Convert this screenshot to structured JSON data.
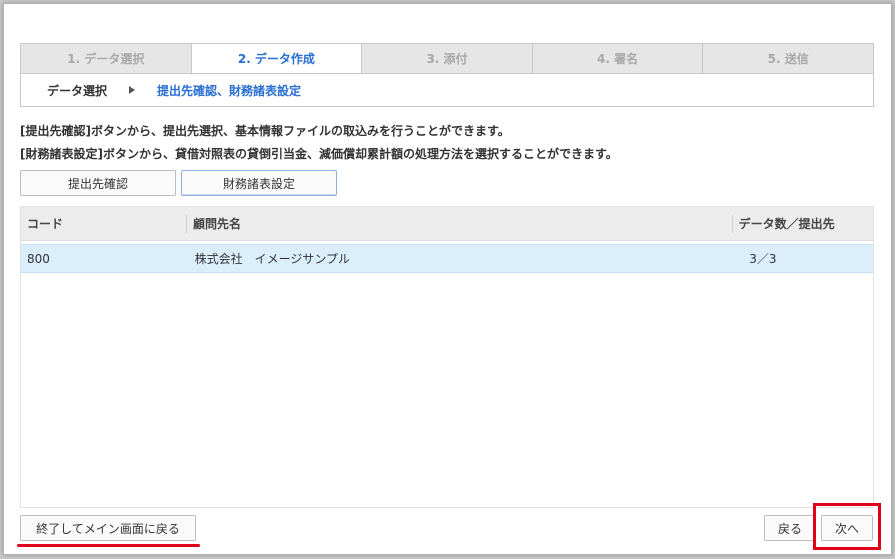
{
  "steps": [
    {
      "label": "1. データ選択",
      "active": false
    },
    {
      "label": "2. データ作成",
      "active": true
    },
    {
      "label": "3. 添付",
      "active": false
    },
    {
      "label": "4. 署名",
      "active": false
    },
    {
      "label": "5. 送信",
      "active": false
    }
  ],
  "substeps": {
    "done": "データ選択",
    "current": "提出先確認、財務諸表設定"
  },
  "description": {
    "line1": "[提出先確認]ボタンから、提出先選択、基本情報ファイルの取込みを行うことができます。",
    "line2": "[財務諸表設定]ボタンから、貸借対照表の貸倒引当金、減価償却累計額の処理方法を選択することができます。"
  },
  "buttons": {
    "confirm": "提出先確認",
    "settings": "財務諸表設定",
    "exit": "終了してメイン画面に戻る",
    "back": "戻る",
    "next": "次へ"
  },
  "table": {
    "headers": [
      "コード",
      "顧問先名",
      "データ数／提出先"
    ],
    "rows": [
      {
        "code": "800",
        "name": "株式会社　イメージサンプル",
        "count": "3／3"
      }
    ]
  },
  "colors": {
    "active_tab_text": "#2a6fd3",
    "selected_row": "#dbeefb",
    "highlight": "#e0001b"
  }
}
